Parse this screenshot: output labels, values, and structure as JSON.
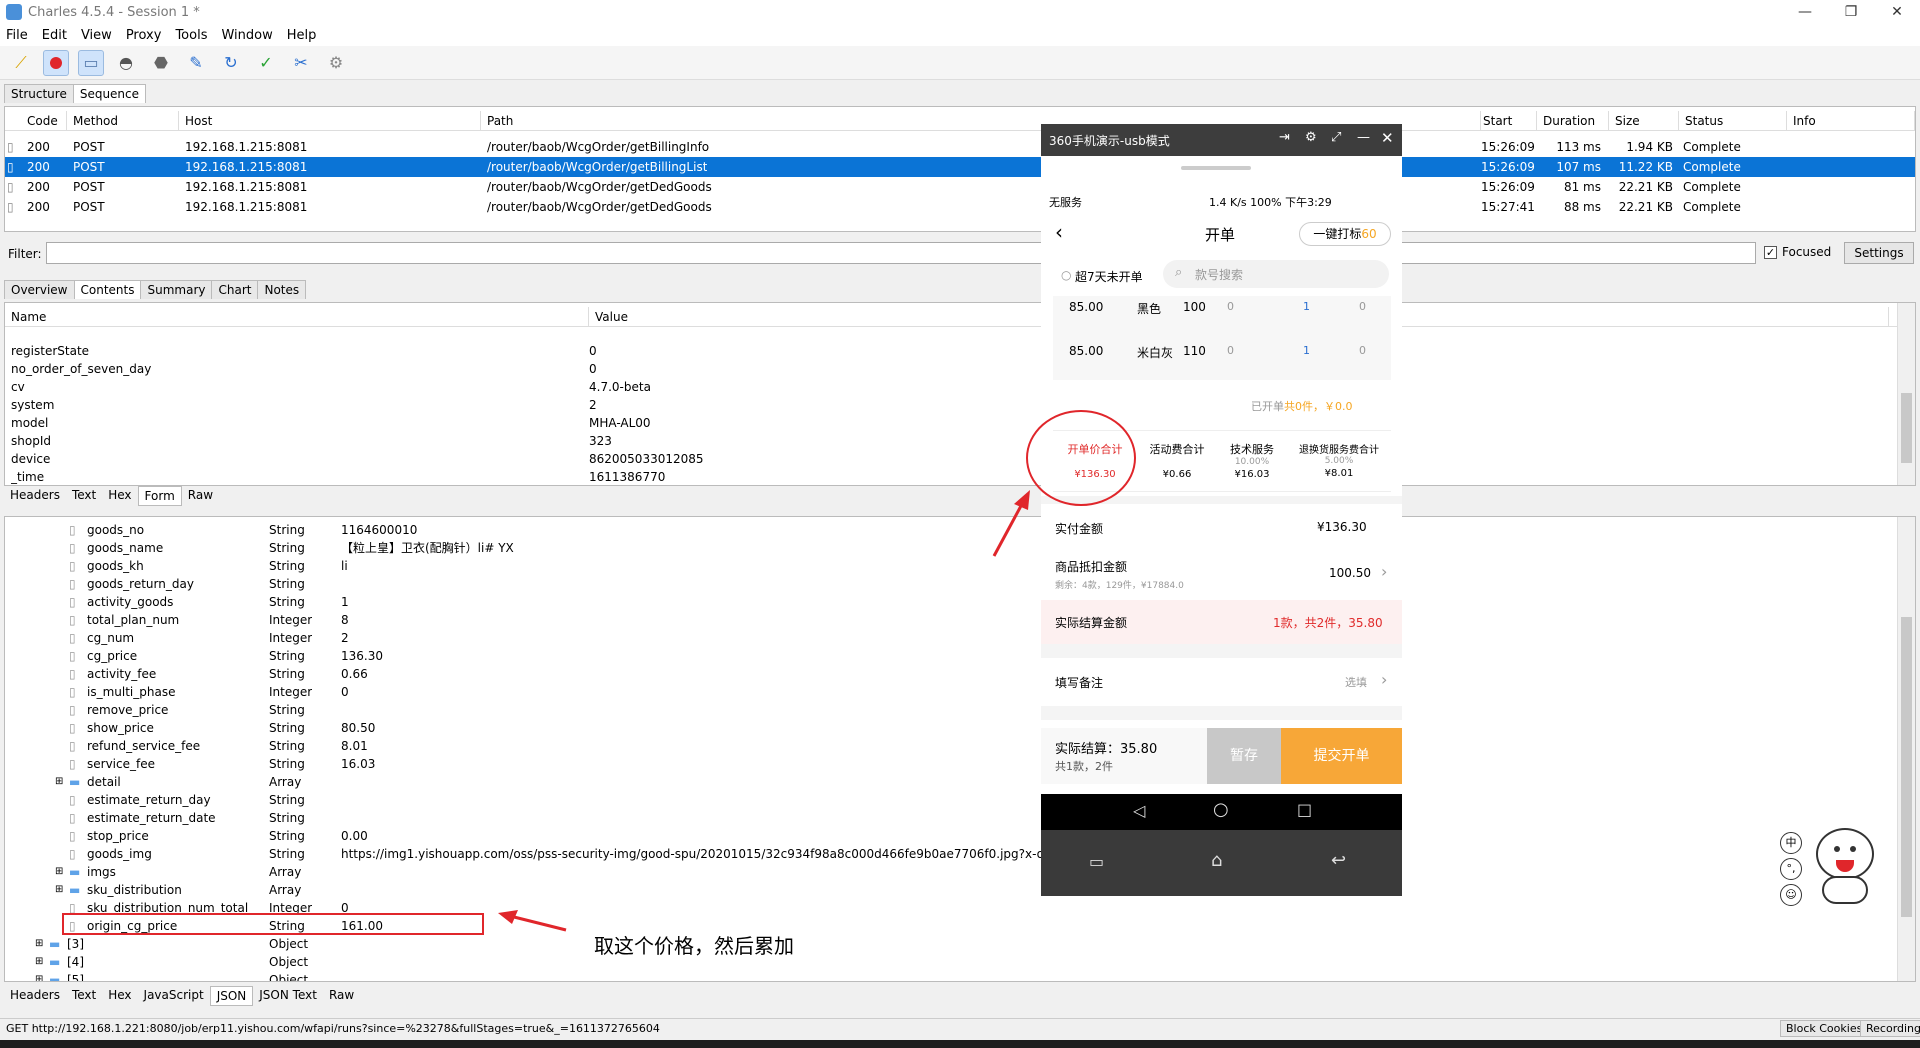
{
  "window": {
    "title": "Charles 4.5.4 - Session 1 *"
  },
  "menu": [
    "File",
    "Edit",
    "View",
    "Proxy",
    "Tools",
    "Window",
    "Help"
  ],
  "top_tabs": [
    "Structure",
    "Sequence"
  ],
  "sequence": {
    "columns": [
      "Code",
      "Method",
      "Host",
      "Path",
      "Start",
      "Duration",
      "Size",
      "Status",
      "Info"
    ],
    "rows": [
      {
        "code": "200",
        "method": "POST",
        "host": "192.168.1.215:8081",
        "path": "/router/baob/WcgOrder/getBillingInfo",
        "start": "15:26:09",
        "duration": "113 ms",
        "size": "1.94 KB",
        "status": "Complete"
      },
      {
        "code": "200",
        "method": "POST",
        "host": "192.168.1.215:8081",
        "path": "/router/baob/WcgOrder/getBillingList",
        "start": "15:26:09",
        "duration": "107 ms",
        "size": "11.22 KB",
        "status": "Complete"
      },
      {
        "code": "200",
        "method": "POST",
        "host": "192.168.1.215:8081",
        "path": "/router/baob/WcgOrder/getDedGoods",
        "start": "15:26:09",
        "duration": "81 ms",
        "size": "22.21 KB",
        "status": "Complete"
      },
      {
        "code": "200",
        "method": "POST",
        "host": "192.168.1.215:8081",
        "path": "/router/baob/WcgOrder/getDedGoods",
        "start": "15:27:41",
        "duration": "88 ms",
        "size": "22.21 KB",
        "status": "Complete"
      }
    ]
  },
  "filter": {
    "label": "Filter:",
    "focused": "Focused",
    "settings": "Settings"
  },
  "detail_tabs": [
    "Overview",
    "Contents",
    "Summary",
    "Chart",
    "Notes"
  ],
  "request": {
    "columns": [
      "Name",
      "Value"
    ],
    "rows": [
      {
        "name": "registerState",
        "value": "0"
      },
      {
        "name": "no_order_of_seven_day",
        "value": "0"
      },
      {
        "name": "cv",
        "value": "4.7.0-beta"
      },
      {
        "name": "system",
        "value": "2"
      },
      {
        "name": "model",
        "value": "MHA-AL00"
      },
      {
        "name": "shopId",
        "value": "323"
      },
      {
        "name": "device",
        "value": "862005033012085"
      },
      {
        "name": "_time",
        "value": "1611386770"
      }
    ],
    "tabs": [
      "Headers",
      "Text",
      "Hex",
      "Form",
      "Raw"
    ]
  },
  "response": {
    "rows": [
      {
        "name": "goods_no",
        "type": "String",
        "value": "1164600010",
        "kind": "leaf"
      },
      {
        "name": "goods_name",
        "type": "String",
        "value": "【粒上皇】卫衣(配胸针）li#  YX",
        "kind": "leaf"
      },
      {
        "name": "goods_kh",
        "type": "String",
        "value": "li",
        "kind": "leaf"
      },
      {
        "name": "goods_return_day",
        "type": "String",
        "value": "",
        "kind": "leaf"
      },
      {
        "name": "activity_goods",
        "type": "String",
        "value": "1",
        "kind": "leaf"
      },
      {
        "name": "total_plan_num",
        "type": "Integer",
        "value": "8",
        "kind": "leaf"
      },
      {
        "name": "cg_num",
        "type": "Integer",
        "value": "2",
        "kind": "leaf"
      },
      {
        "name": "cg_price",
        "type": "String",
        "value": "136.30",
        "kind": "leaf"
      },
      {
        "name": "activity_fee",
        "type": "String",
        "value": "0.66",
        "kind": "leaf"
      },
      {
        "name": "is_multi_phase",
        "type": "Integer",
        "value": "0",
        "kind": "leaf"
      },
      {
        "name": "remove_price",
        "type": "String",
        "value": "",
        "kind": "leaf"
      },
      {
        "name": "show_price",
        "type": "String",
        "value": "80.50",
        "kind": "leaf"
      },
      {
        "name": "refund_service_fee",
        "type": "String",
        "value": "8.01",
        "kind": "leaf"
      },
      {
        "name": "service_fee",
        "type": "String",
        "value": "16.03",
        "kind": "leaf"
      },
      {
        "name": "detail",
        "type": "Array",
        "value": "",
        "kind": "folder"
      },
      {
        "name": "estimate_return_day",
        "type": "String",
        "value": "",
        "kind": "leaf"
      },
      {
        "name": "estimate_return_date",
        "type": "String",
        "value": "",
        "kind": "leaf"
      },
      {
        "name": "stop_price",
        "type": "String",
        "value": "0.00",
        "kind": "leaf"
      },
      {
        "name": "goods_img",
        "type": "String",
        "value": "https://img1.yishouapp.com/oss/pss-security-img/good-spu/20201015/32c934f98a8c000d466fe9b0ae7706f0.jpg?x-oss-p",
        "kind": "leaf"
      },
      {
        "name": "imgs",
        "type": "Array",
        "value": "",
        "kind": "folder"
      },
      {
        "name": "sku_distribution",
        "type": "Array",
        "value": "",
        "kind": "folder"
      },
      {
        "name": "sku_distribution_num_total",
        "type": "Integer",
        "value": "0",
        "kind": "leaf"
      },
      {
        "name": "origin_cg_price",
        "type": "String",
        "value": "161.00",
        "kind": "leaf"
      },
      {
        "name": "[3]",
        "type": "Object",
        "value": "",
        "kind": "folder-top"
      },
      {
        "name": "[4]",
        "type": "Object",
        "value": "",
        "kind": "folder-top"
      },
      {
        "name": "[5]",
        "type": "Object",
        "value": "",
        "kind": "folder-top"
      }
    ],
    "tabs": [
      "Headers",
      "Text",
      "Hex",
      "JavaScript",
      "JSON",
      "JSON Text",
      "Raw"
    ]
  },
  "annotation": {
    "note": "取这个价格，然后累加"
  },
  "status": {
    "url": "GET http://192.168.1.221:8080/job/erp11.yishou.com/wfapi/runs?since=%23278&fullStages=true&_=1611372765604",
    "block_cookies": "Block Cookies",
    "recording": "Recording"
  },
  "phone": {
    "window_title": "360手机演示-usb模式",
    "statusbar_left": "无服务",
    "statusbar_right": "1.4 K/s  100%  下午3:29",
    "page_title": "开单",
    "print_btn_label": "一键打标",
    "print_btn_count": "60",
    "checkbox_label": "超7天未开单",
    "search_placeholder": "款号搜索",
    "sku_rows": [
      {
        "price": "85.00",
        "color": "黑色",
        "size": "100",
        "a": "0",
        "b": "1",
        "c": "0"
      },
      {
        "price": "85.00",
        "color": "米白灰",
        "size": "110",
        "a": "0",
        "b": "1",
        "c": "0"
      }
    ],
    "opened_summary_prefix": "已开单",
    "opened_summary_value": "共0件，￥0.0",
    "fees": [
      {
        "label": "开单价合计",
        "pct": "",
        "value": "¥136.30"
      },
      {
        "label": "活动费合计",
        "pct": "",
        "value": "¥0.66"
      },
      {
        "label": "技术服务",
        "pct": "10.00%",
        "value": "¥16.03"
      },
      {
        "label": "退换货服务费合计",
        "pct": "5.00%",
        "value": "¥8.01"
      }
    ],
    "actual_pay_label": "实付金额",
    "actual_pay_value": "¥136.30",
    "deduct_label": "商品抵扣金额",
    "deduct_sub": "剩余：4款，129件，¥17884.0",
    "deduct_value": "100.50",
    "settle_label": "实际结算金额",
    "settle_value": "1款，共2件，35.80",
    "remark_label": "填写备注",
    "remark_hint": "选填",
    "bottom_total": "实际结算：35.80",
    "bottom_sub": "共1款，2件",
    "save_btn": "暂存",
    "submit_btn": "提交开单"
  }
}
